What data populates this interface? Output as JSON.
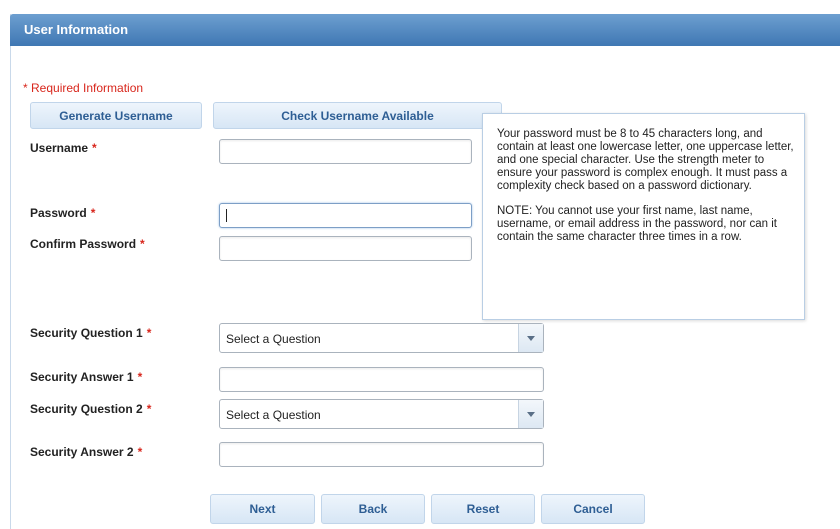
{
  "header": {
    "title": "User Information"
  },
  "required_note": "* Required Information",
  "top_buttons": {
    "generate": "Generate Username",
    "check": "Check Username Available"
  },
  "form": {
    "username_label": "Username",
    "password_label": "Password",
    "confirm_password_label": "Confirm Password",
    "security_question_1_label": "Security Question 1",
    "security_answer_1_label": "Security Answer 1",
    "security_question_2_label": "Security Question 2",
    "security_answer_2_label": "Security Answer 2",
    "required_marker": "*",
    "username_value": "",
    "password_value": "",
    "confirm_password_value": "",
    "security_answer_1_value": "",
    "security_answer_2_value": "",
    "security_question_1_selected": "Select a Question",
    "security_question_2_selected": "Select a Question"
  },
  "tooltip": {
    "paragraph1": "Your password must be 8 to 45 characters long, and contain at least one lowercase letter, one uppercase letter, and one special character. Use the strength meter to ensure your password is complex enough. It must pass a complexity check based on a password dictionary.",
    "paragraph2": "NOTE: You cannot use your first name, last name, username, or email address in the password, nor can it contain the same character three times in a row."
  },
  "bottom_buttons": {
    "next": "Next",
    "back": "Back",
    "reset": "Reset",
    "cancel": "Cancel"
  },
  "icons": {
    "dropdown": "chevron-down-icon"
  },
  "colors": {
    "header": "#4a82bd",
    "required": "#d8261c",
    "button_text": "#2e5e94"
  }
}
